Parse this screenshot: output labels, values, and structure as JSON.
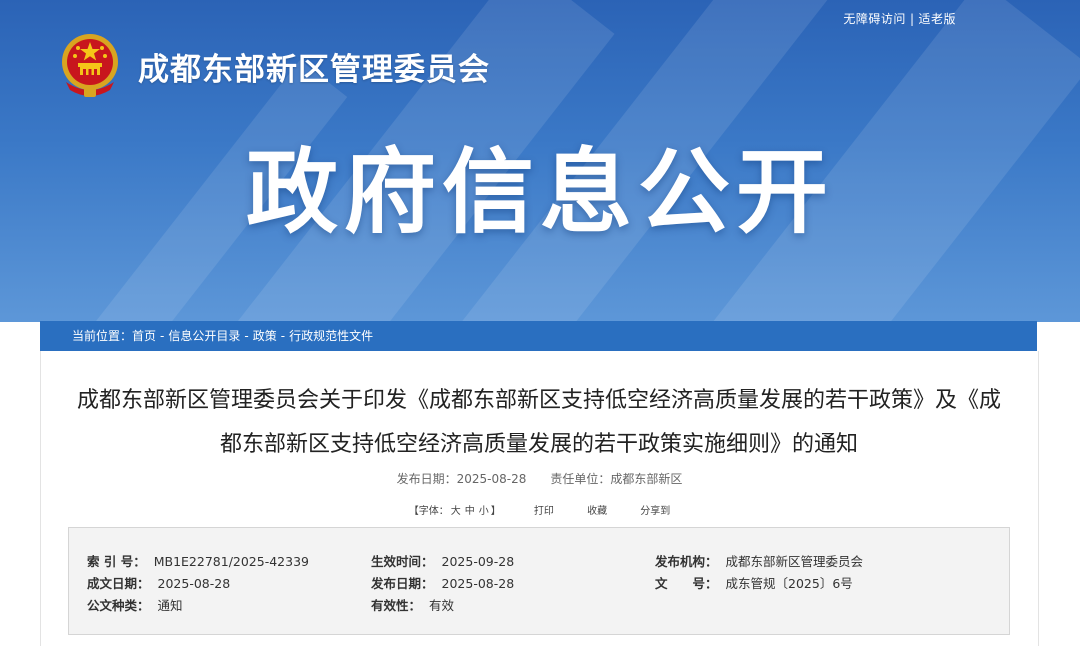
{
  "header": {
    "top_links": [
      "无障碍访问",
      "适老版"
    ],
    "top_link_separator": "|",
    "org_name": "成都东部新区管理委员会",
    "hero_title": "政府信息公开",
    "emblem_icon": "national-emblem-icon"
  },
  "breadcrumb": {
    "prefix": "当前位置：",
    "items": [
      "首页",
      "信息公开目录",
      "政策",
      "行政规范性文件"
    ],
    "separator": "-"
  },
  "article": {
    "title_line1": "成都东部新区管理委员会关于印发《成都东部新区支持低空经济高质量发展的若干政策》及《成",
    "title_line2": "都东部新区支持低空经济高质量发展的若干政策实施细则》的通知",
    "publish_date_label": "发布日期：",
    "publish_date": "2025-08-28",
    "responsible_label": "责任单位：",
    "responsible": "成都东部新区"
  },
  "toolbar": {
    "font_open": "【字体：",
    "font_sizes": [
      "大",
      "中",
      "小"
    ],
    "font_close": "】",
    "print": "打印",
    "favorite": "收藏",
    "share": "分享到"
  },
  "info": {
    "index_no_label": "索 引 号：",
    "index_no": "MB1E22781/2025-42339",
    "effective_time_label": "生效时间：",
    "effective_time": "2025-09-28",
    "issuer_label": "发布机构：",
    "issuer": "成都东部新区管理委员会",
    "written_date_label": "成文日期：",
    "written_date": "2025-08-28",
    "publish_date_label": "发布日期：",
    "publish_date": "2025-08-28",
    "doc_no_label": "文　　号：",
    "doc_no": "成东管规〔2025〕6号",
    "doc_type_label": "公文种类：",
    "doc_type": "通知",
    "validity_label": "有效性：",
    "validity": "有效"
  },
  "colors": {
    "banner_blue": "#2b63b6",
    "breadcrumb_bar": "#2a6fc0",
    "info_box_bg": "#f3f3f3"
  }
}
